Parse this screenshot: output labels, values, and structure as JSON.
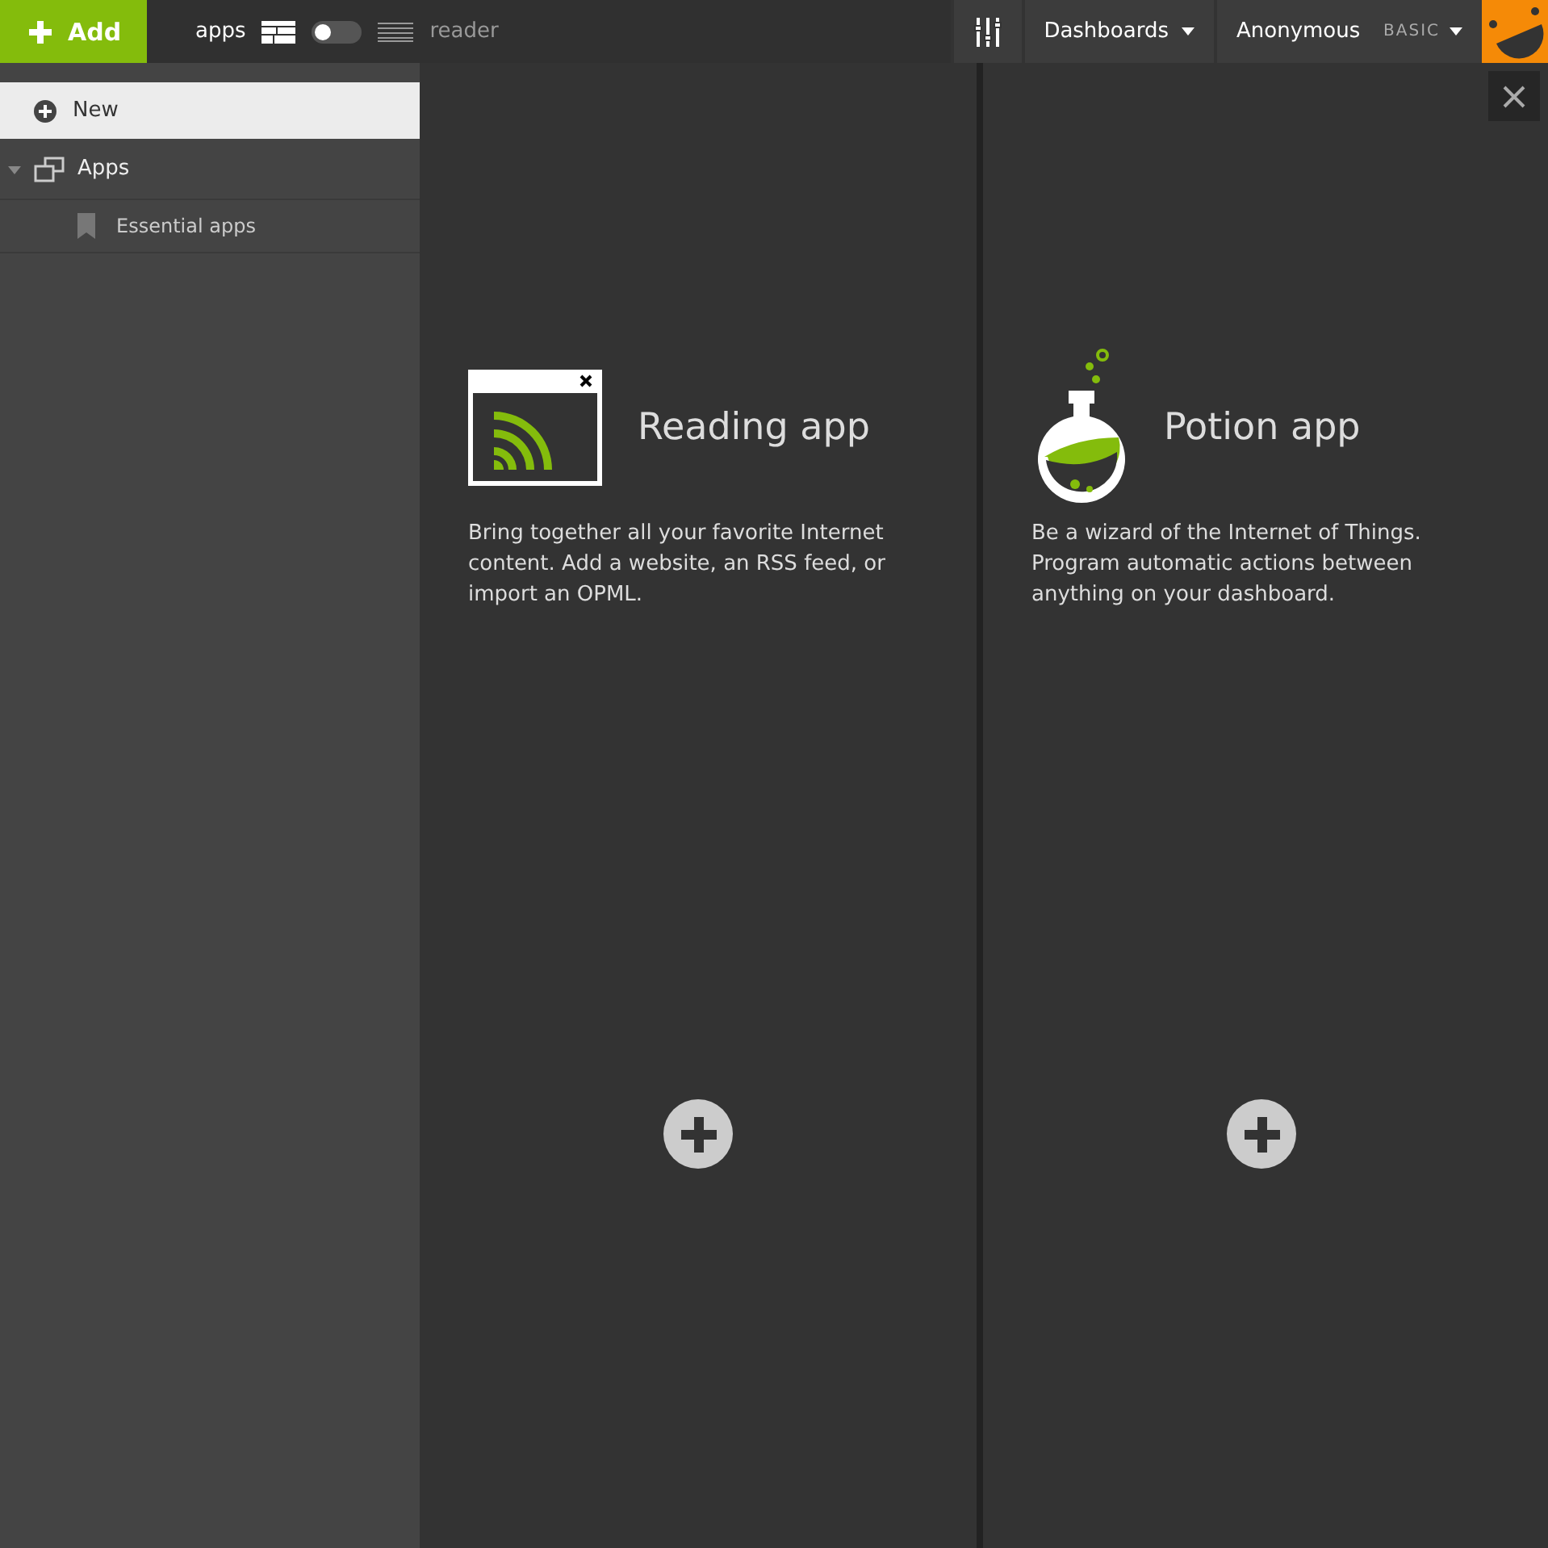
{
  "topbar": {
    "add_button": "Add",
    "view_toggle": {
      "left_label": "apps",
      "right_label": "reader",
      "on": false
    },
    "dashboards_menu": "Dashboards",
    "user_menu": {
      "name": "Anonymous",
      "plan": "BASIC"
    }
  },
  "sidebar": {
    "new_field": {
      "value": "New"
    },
    "tree": [
      {
        "label": "Apps",
        "expanded": true,
        "children": [
          {
            "label": "Essential apps"
          }
        ]
      }
    ]
  },
  "apps": [
    {
      "kind": "reading",
      "title": "Reading app",
      "description": "Bring together all your favorite Internet content. Add a website, an RSS feed, or import an OPML."
    },
    {
      "kind": "potion",
      "title": "Potion app",
      "description": "Be a wizard of the Internet of Things. Program automatic actions between anything on your dashboard."
    }
  ]
}
